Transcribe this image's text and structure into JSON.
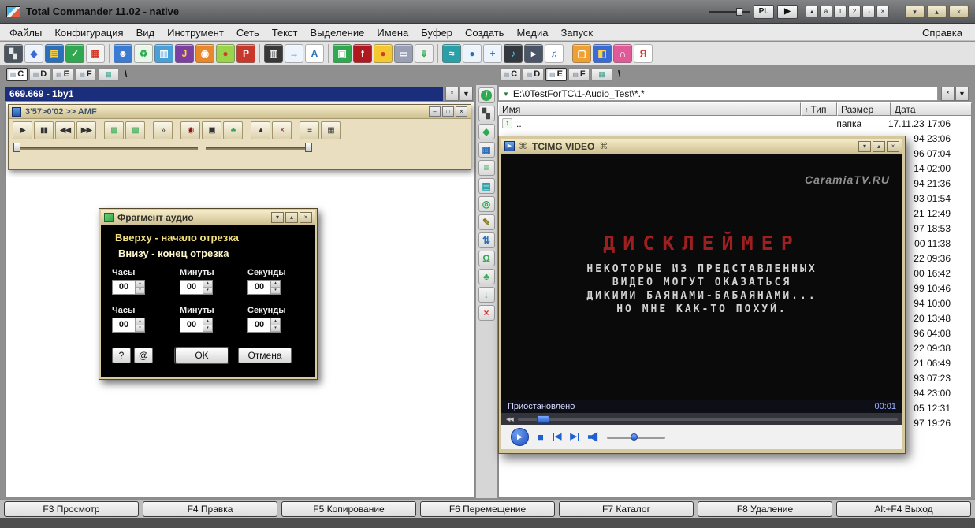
{
  "colors": {
    "navy": "#1b2e7b",
    "yellow": "#f2df7e",
    "pale-yellow": "#fcf6cf",
    "red-title": "#9e1f1f",
    "blue": "#1f5fd0",
    "green": "#2fa84f"
  },
  "window_controls": {
    "minimize": "▾",
    "maximize": "▴",
    "close": "×"
  },
  "titlebar": {
    "title": "Total Commander 11.02 - native",
    "pl_button": "PL",
    "play_button": "▶",
    "mini_buttons": [
      "▴",
      "a",
      "1",
      "2",
      "♪",
      "×"
    ]
  },
  "menubar": {
    "items": [
      "Файлы",
      "Конфигурация",
      "Вид",
      "Инструмент",
      "Сеть",
      "Текст",
      "Выделение",
      "Имена",
      "Буфер",
      "Создать",
      "Медиа",
      "Запуск"
    ],
    "help": "Справка"
  },
  "toolbar": {
    "separators_after": [
      4,
      11,
      14,
      19,
      25
    ],
    "icons": [
      {
        "name": "dos-box",
        "glyph": "▚",
        "bg": "#4a5560",
        "fg": "#e8e8e8"
      },
      {
        "name": "disk-check",
        "glyph": "◆",
        "bg": "#eef2fb",
        "fg": "#3a6bd4"
      },
      {
        "name": "tv",
        "glyph": "▤",
        "bg": "#2b6fb8",
        "fg": "#ffd24a"
      },
      {
        "name": "antivirus-shield",
        "glyph": "✓",
        "bg": "#2fa84f",
        "fg": "#ffffff"
      },
      {
        "name": "color-grid",
        "glyph": "▦",
        "bg": "#f3f3f3",
        "fg": "#d43a2a"
      },
      {
        "name": "users",
        "glyph": "☻",
        "bg": "#3b7bd4",
        "fg": "#ffffff"
      },
      {
        "name": "recycle",
        "glyph": "♻",
        "bg": "#eaf6ea",
        "fg": "#2fa84f"
      },
      {
        "name": "striped-monitor",
        "glyph": "▥",
        "bg": "#49a0d8",
        "fg": "#ffffff"
      },
      {
        "name": "media-player-j",
        "glyph": "J",
        "bg": "#7a3fa0",
        "fg": "#ffd24a"
      },
      {
        "name": "camera",
        "glyph": "◉",
        "bg": "#e8882a",
        "fg": "#ffffff"
      },
      {
        "name": "capsule",
        "glyph": "●",
        "bg": "#9ad44a",
        "fg": "#d43a2a"
      },
      {
        "name": "pdf",
        "glyph": "P",
        "bg": "#c8382a",
        "fg": "#ffffff"
      },
      {
        "name": "film",
        "glyph": "▥",
        "bg": "#383838",
        "fg": "#e8e8e8"
      },
      {
        "name": "doc-export",
        "glyph": "→",
        "bg": "#eef4fb",
        "fg": "#2b6fb8"
      },
      {
        "name": "text-a",
        "glyph": "A",
        "bg": "#ffffff",
        "fg": "#2b6fb8"
      },
      {
        "name": "green-monitor",
        "glyph": "▣",
        "bg": "#2fa84f",
        "fg": "#ffffff"
      },
      {
        "name": "flash",
        "glyph": "f",
        "bg": "#b01820",
        "fg": "#ffffff"
      },
      {
        "name": "chart-pie",
        "glyph": "●",
        "bg": "#f5c832",
        "fg": "#d43a2a"
      },
      {
        "name": "scanner",
        "glyph": "▭",
        "bg": "#9aa0b4",
        "fg": "#ffffff"
      },
      {
        "name": "table-import",
        "glyph": "⇓",
        "bg": "#f0f0f0",
        "fg": "#2fa84f"
      },
      {
        "name": "flow",
        "glyph": "≈",
        "bg": "#28a0a8",
        "fg": "#ffffff"
      },
      {
        "name": "globe",
        "glyph": "●",
        "bg": "#eef4fb",
        "fg": "#2b6fb8"
      },
      {
        "name": "blue-cross",
        "glyph": "+",
        "bg": "#eef4fb",
        "fg": "#2b6fb8"
      },
      {
        "name": "mp3",
        "glyph": "♪",
        "bg": "#33383f",
        "fg": "#4ad4ff"
      },
      {
        "name": "player-skin",
        "glyph": "▸",
        "bg": "#4a5668",
        "fg": "#ffffff"
      },
      {
        "name": "music-note",
        "glyph": "♫",
        "bg": "#ffffff",
        "fg": "#2b6fb8"
      },
      {
        "name": "orange-tool",
        "glyph": "▢",
        "bg": "#f0a030",
        "fg": "#ffffff"
      },
      {
        "name": "blue-red-split",
        "glyph": "◧",
        "bg": "#3a6ad4",
        "fg": "#ffd24a"
      },
      {
        "name": "headphones",
        "glyph": "∩",
        "bg": "#e05a9a",
        "fg": "#ffffff"
      },
      {
        "name": "cyrillic-ya",
        "glyph": "Я",
        "bg": "#ffffff",
        "fg": "#d43a2a"
      }
    ]
  },
  "left_panel": {
    "drives": [
      "C",
      "D",
      "E",
      "F"
    ],
    "active_drive": "C",
    "root_label": "\\",
    "header": "669.669 - 1by1",
    "header_buttons": [
      "*",
      "▼"
    ]
  },
  "right_panel": {
    "drives": [
      "C",
      "D",
      "E",
      "F"
    ],
    "active_drive": "E",
    "root_label": "\\",
    "path": "E:\\0TestForTC\\1-Audio_Test\\*.*",
    "path_buttons": [
      "*",
      "▼"
    ],
    "columns": [
      {
        "label": "Имя",
        "sort": ""
      },
      {
        "label": "Тип",
        "sort": "↑"
      },
      {
        "label": "Размер",
        "sort": ""
      },
      {
        "label": "Дата",
        "sort": ""
      }
    ],
    "first_row": {
      "icon": "↑",
      "name": "..",
      "size": "папка",
      "date": "17.11.23 17:06"
    },
    "date_fragments": [
      "94 23:06",
      "96 07:04",
      "14 02:00",
      "94 21:36",
      "93 01:54",
      "21 12:49",
      "97 18:53",
      "00 11:38",
      "22 09:36",
      "00 16:42",
      "99 10:46",
      "94 10:00",
      "20 13:48",
      "96 04:08",
      "22 09:38",
      "21 06:49",
      "93 07:23",
      "94 23:00",
      "05 12:31",
      "97 19:26"
    ]
  },
  "strip": {
    "icons": [
      {
        "name": "info",
        "glyph": "i",
        "fg": "#ffffff",
        "bg": "#2fa84f",
        "round": true
      },
      {
        "name": "spider",
        "glyph": "▚",
        "fg": "#444444"
      },
      {
        "name": "gem",
        "glyph": "◆",
        "fg": "#2fa84f"
      },
      {
        "name": "grid",
        "glyph": "▦",
        "fg": "#2b6fb8"
      },
      {
        "name": "layers",
        "glyph": "≡",
        "fg": "#2fa84f"
      },
      {
        "name": "table",
        "glyph": "▤",
        "fg": "#28a0a8"
      },
      {
        "name": "search",
        "glyph": "◎",
        "fg": "#2fa84f"
      },
      {
        "name": "edit",
        "glyph": "✎",
        "fg": "#8a7a1a"
      },
      {
        "name": "sync",
        "glyph": "⇅",
        "fg": "#2b6fb8"
      },
      {
        "name": "omega",
        "glyph": "Ω",
        "fg": "#2fa84f"
      },
      {
        "name": "clover",
        "glyph": "♣",
        "fg": "#2fa84f"
      },
      {
        "name": "download",
        "glyph": "↓",
        "fg": "#2fa84f"
      },
      {
        "name": "delete",
        "glyph": "×",
        "fg": "#d42a2a"
      }
    ]
  },
  "player": {
    "title": "3'57>0'02 >> AMF",
    "window_buttons": [
      "–",
      "□",
      "×"
    ],
    "buttons": [
      {
        "name": "play",
        "glyph": "▶"
      },
      {
        "name": "pause",
        "glyph": "▮▮"
      },
      {
        "name": "previous",
        "glyph": "◀◀"
      },
      {
        "name": "next",
        "glyph": "▶▶"
      },
      {
        "name": "image-1",
        "glyph": "▩",
        "color": "#2fa84f",
        "gap": true
      },
      {
        "name": "image-2",
        "glyph": "▩",
        "color": "#2fa84f"
      },
      {
        "name": "fast-forward",
        "glyph": "»",
        "gap": true
      },
      {
        "name": "record",
        "glyph": "◉",
        "color": "#8a1a1a",
        "gap": true
      },
      {
        "name": "window",
        "glyph": "▣"
      },
      {
        "name": "leaf",
        "glyph": "♣",
        "color": "#2fa84f"
      },
      {
        "name": "eject",
        "glyph": "▲",
        "gap": true
      },
      {
        "name": "close",
        "glyph": "×",
        "color": "#7a1a1a"
      },
      {
        "name": "playlist",
        "glyph": "≡",
        "gap": true
      },
      {
        "name": "grid",
        "glyph": "▦"
      }
    ]
  },
  "dialog": {
    "title": "Фрагмент аудио",
    "line1": "Вверху - начало отрезка",
    "line2": "Внизу - конец отрезка",
    "time_labels": [
      "Часы",
      "Минуты",
      "Секунды"
    ],
    "start_values": [
      "00",
      "00",
      "00"
    ],
    "end_values": [
      "00",
      "00",
      "00"
    ],
    "small_buttons": [
      "?",
      "@"
    ],
    "ok": "OK",
    "cancel": "Отмена"
  },
  "video": {
    "decor": "⌘",
    "title": "TCIMG VIDEO",
    "logo": "CaramiaTV.RU",
    "disclaimer_title": "ДИСКЛЕЙМЕР",
    "disclaimer_lines": [
      "НЕКОТОРЫЕ ИЗ ПРЕДСТАВЛЕННЫХ",
      "ВИДЕО МОГУТ ОКАЗАТЬСЯ",
      "ДИКИМИ БАЯНАМИ-БАБАЯНАМИ...",
      "НО МНЕ КАК-ТО ПОХУЙ."
    ],
    "status": "Приостановлено",
    "time": "00:01",
    "seek_arrows": "◀◀"
  },
  "function_bar": {
    "buttons": [
      "F3 Просмотр",
      "F4 Правка",
      "F5 Копирование",
      "F6 Перемещение",
      "F7 Каталог",
      "F8 Удаление",
      "Alt+F4 Выход"
    ]
  }
}
